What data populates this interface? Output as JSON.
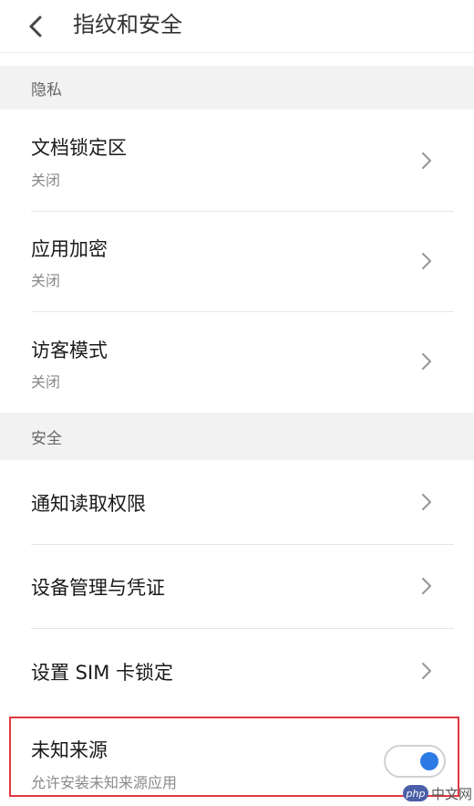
{
  "header": {
    "title": "指纹和安全",
    "back_icon": "chevron-left-icon"
  },
  "sections": {
    "privacy": {
      "label": "隐私",
      "items": [
        {
          "title": "文档锁定区",
          "subtitle": "关闭"
        },
        {
          "title": "应用加密",
          "subtitle": "关闭"
        },
        {
          "title": "访客模式",
          "subtitle": "关闭"
        }
      ]
    },
    "security": {
      "label": "安全",
      "items": [
        {
          "title": "通知读取权限"
        },
        {
          "title": "设备管理与凭证"
        },
        {
          "title": "设置 SIM 卡锁定"
        }
      ],
      "unknown_sources": {
        "title": "未知来源",
        "subtitle": "允许安装未知来源应用",
        "enabled": true
      }
    }
  },
  "watermark": {
    "logo_text": "php",
    "text": "中文网"
  },
  "colors": {
    "accent": "#2c7be5",
    "highlight_border": "#e0383e",
    "section_bg": "#f2f2f2"
  }
}
